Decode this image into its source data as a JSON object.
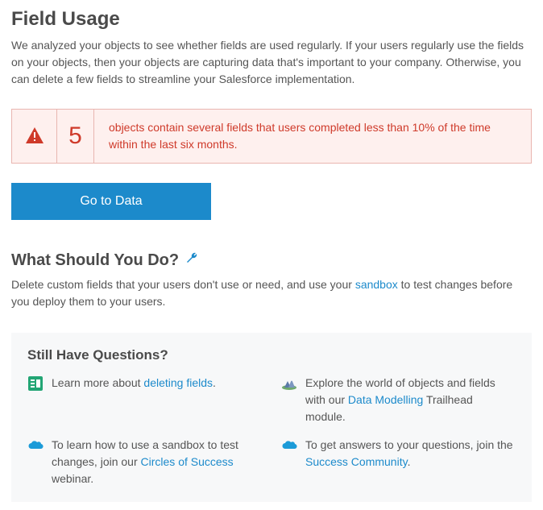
{
  "header": {
    "title": "Field Usage",
    "description": "We analyzed your objects to see whether fields are used regularly. If your users regularly use the fields on your objects, then your objects are capturing data that's important to your company. Otherwise, you can delete a few fields to streamline your Salesforce implementation."
  },
  "alert": {
    "count": "5",
    "message": "objects contain several fields that users completed less than 10% of the time within the last six months."
  },
  "cta": {
    "label": "Go to Data"
  },
  "recommend": {
    "title": "What Should You Do?",
    "text_before": "Delete custom fields that your users don't use or need, and use your ",
    "link": "sandbox",
    "text_after": " to test changes before you deploy them to your users."
  },
  "questions": {
    "title": "Still Have Questions?",
    "items": [
      {
        "before": "Learn more about ",
        "link": "deleting fields",
        "after": "."
      },
      {
        "before": "Explore the world of objects and fields with our ",
        "link": "Data Modelling",
        "after": " Trailhead module."
      },
      {
        "before": "To learn how to use a sandbox to test changes, join our ",
        "link": "Circles of Success",
        "after": " webinar."
      },
      {
        "before": "To get answers to your questions, join the ",
        "link": "Success Community",
        "after": "."
      }
    ]
  }
}
